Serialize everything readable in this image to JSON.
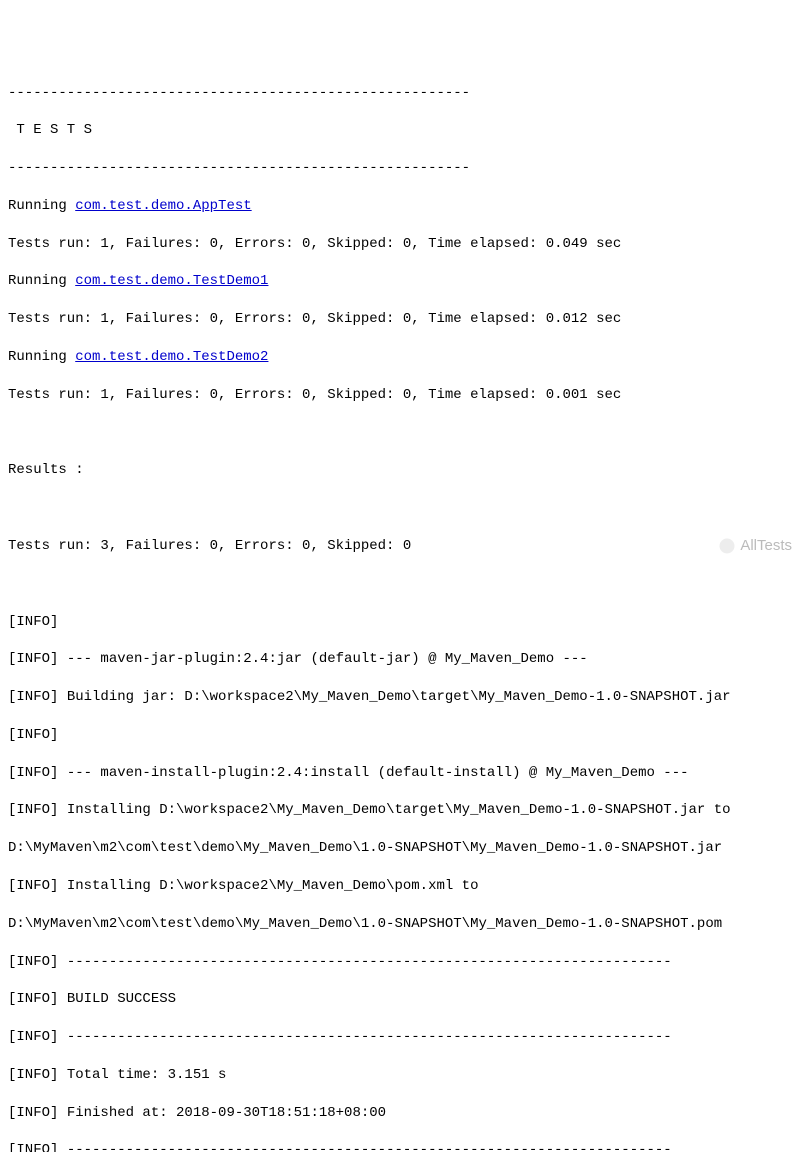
{
  "sep_top": "-------------------------------------------------------",
  "tests_header": " T E S T S",
  "sep_mid": "-------------------------------------------------------",
  "running_label": "Running ",
  "runs": [
    {
      "class": "com.test.demo.AppTest",
      "result": "Tests run: 1, Failures: 0, Errors: 0, Skipped: 0, Time elapsed: 0.049 sec"
    },
    {
      "class": "com.test.demo.TestDemo1",
      "result": "Tests run: 1, Failures: 0, Errors: 0, Skipped: 0, Time elapsed: 0.012 sec"
    },
    {
      "class": "com.test.demo.TestDemo2",
      "result": "Tests run: 1, Failures: 0, Errors: 0, Skipped: 0, Time elapsed: 0.001 sec"
    }
  ],
  "results_label": "Results :",
  "results_summary": "Tests run: 3, Failures: 0, Errors: 0, Skipped: 0",
  "info_prefix": "[INFO] ",
  "info_bare": "[INFO]",
  "info": {
    "jar_plugin": "--- maven-jar-plugin:2.4:jar (default-jar) @ My_Maven_Demo ---",
    "building_jar": "Building jar: D:\\workspace2\\My_Maven_Demo\\target\\My_Maven_Demo-1.0-SNAPSHOT.jar",
    "install_plugin": "--- maven-install-plugin:2.4:install (default-install) @ My_Maven_Demo ---",
    "installing_jar": "Installing D:\\workspace2\\My_Maven_Demo\\target\\My_Maven_Demo-1.0-SNAPSHOT.jar to",
    "installing_jar_dest": "D:\\MyMaven\\m2\\com\\test\\demo\\My_Maven_Demo\\1.0-SNAPSHOT\\My_Maven_Demo-1.0-SNAPSHOT.jar",
    "installing_pom": "Installing D:\\workspace2\\My_Maven_Demo\\pom.xml to",
    "installing_pom_dest": "D:\\MyMaven\\m2\\com\\test\\demo\\My_Maven_Demo\\1.0-SNAPSHOT\\My_Maven_Demo-1.0-SNAPSHOT.pom",
    "long_sep": "------------------------------------------------------------------------",
    "build_success": "BUILD SUCCESS",
    "total_time": "Total time: 3.151 s",
    "finished_at": "Finished at: 2018-09-30T18:51:18+08:00"
  },
  "watermark": "AllTests"
}
